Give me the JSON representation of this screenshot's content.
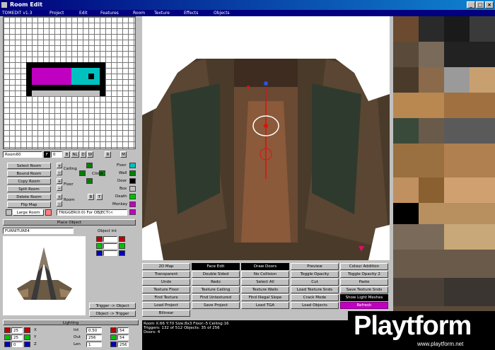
{
  "window": {
    "title": "Room Edit"
  },
  "menu": {
    "version": "TOMEDIT v1.3",
    "items": [
      "Project",
      "Edit",
      "Features",
      "Room",
      "Texture",
      "Effects",
      "Objects"
    ]
  },
  "room_controls": {
    "room_name": "Room60",
    "room_num": "0",
    "toggle_buttons": [
      "B",
      "NL",
      "D",
      "W"
    ],
    "small_buttons": [
      "R",
      "M"
    ],
    "buttons": [
      "Select Room",
      "Bound Room",
      "Copy Room",
      "Split Room",
      "Delete Room",
      "Flip Map",
      "Large Room"
    ],
    "labels": {
      "ceiling": "Ceiling",
      "floor": "Floor",
      "room": "Room",
      "climb": "Climb"
    },
    "bt_buttons": [
      "B",
      "T"
    ],
    "legend": [
      "Floor",
      "Wall",
      "Door",
      "Box",
      "Death",
      "Monkey"
    ],
    "legend_colors": [
      "#00c0c0",
      "#008000",
      "#000000",
      "#c0c0c0",
      "#00c000",
      "#c000c0"
    ],
    "trigger_text": "TRIGGER(0:0) For OBJECT(<"
  },
  "place_object": {
    "header": "Place Object",
    "object_name": "FURNITURE4",
    "object_int_label": "Object Int",
    "trigger_buttons": [
      "Trigger -> Object",
      "Object -> Trigger"
    ]
  },
  "lighting": {
    "header": "Lighting",
    "rows": [
      {
        "v1": "25",
        "axis": "X",
        "int": "Int",
        "val": "0.50",
        "num2": "0",
        "r": "54"
      },
      {
        "v1": "25",
        "axis": "Y",
        "int": "Out",
        "val": "256",
        "num2": "54",
        "r": "54"
      },
      {
        "v1": "0",
        "axis": "Z",
        "int": "Len",
        "val": "1",
        "num2": "256",
        "r": ""
      }
    ]
  },
  "toolbar": {
    "rows": [
      [
        "2D Map",
        "Face Edit",
        "Draw Doors",
        "Preview",
        "Colour Addition"
      ],
      [
        "Transparent",
        "Double Sided",
        "No Collision",
        "Toggle Opacity",
        "Toggle Opacity 2"
      ],
      [
        "Undo",
        "Redo",
        "Select All",
        "Cut",
        "Paste"
      ],
      [
        "Texture Floor",
        "Texture Ceiling",
        "Texture Walls",
        "Load Texture Snds",
        "Save Texture Snds"
      ],
      [
        "Find Texture",
        "Find Untextured",
        "Find Illegal Slope",
        "Crack Mode",
        "Show Light Meshes"
      ],
      [
        "Load Project",
        "Save Project",
        "Load TGA",
        "Load Objects",
        "Refresh"
      ],
      [
        "Bilinear"
      ]
    ]
  },
  "status": {
    "line1": "Room X:66 Y:70    Size:8x3    Floor:-5 Ceiling:16",
    "line2": "Triggers: 132 of 512  Objects: 35 of 256",
    "line3": "Doors: 4"
  },
  "watermark": {
    "brand": "Playtform",
    "url": "www.playtform.net"
  },
  "colors": {
    "accent": "#000080",
    "floor": "#00c0c0",
    "monkey": "#c000c0"
  }
}
